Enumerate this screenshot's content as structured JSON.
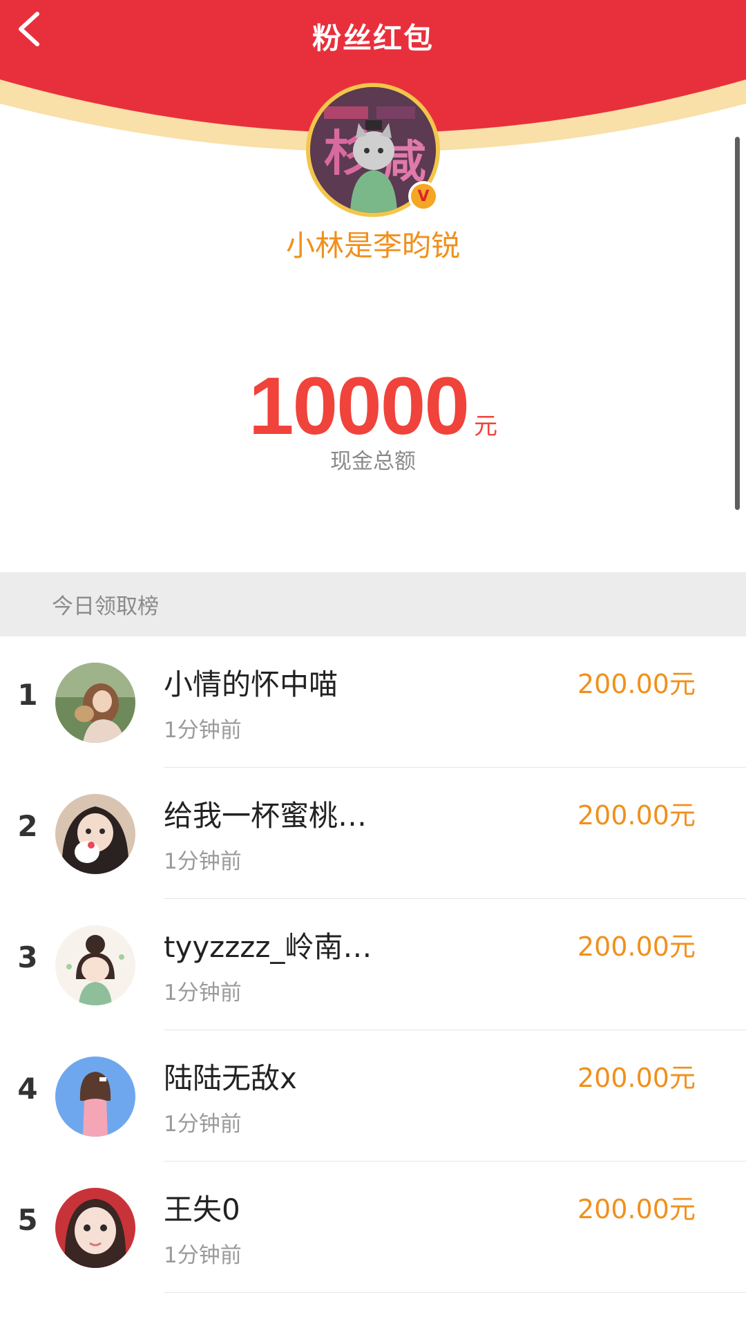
{
  "header": {
    "title": "粉丝红包",
    "back_icon": "chevron-left-icon",
    "bg_color": "#e8303c",
    "band_color": "#f9dfa8"
  },
  "host": {
    "name": "小林是李昀锐",
    "verified_mark": "V"
  },
  "amount": {
    "value": "10000",
    "unit": "元",
    "caption": "现金总额"
  },
  "section": {
    "title": "今日领取榜"
  },
  "claims": [
    {
      "rank": "1",
      "name": "小情的怀中喵",
      "time": "1分钟前",
      "amount": "200.00元"
    },
    {
      "rank": "2",
      "name": "给我一杯蜜桃…",
      "time": "1分钟前",
      "amount": "200.00元"
    },
    {
      "rank": "3",
      "name": "tyyzzzz_岭南…",
      "time": "1分钟前",
      "amount": "200.00元"
    },
    {
      "rank": "4",
      "name": "陆陆无敌x",
      "time": "1分钟前",
      "amount": "200.00元"
    },
    {
      "rank": "5",
      "name": "王失0",
      "time": "1分钟前",
      "amount": "200.00元"
    }
  ]
}
